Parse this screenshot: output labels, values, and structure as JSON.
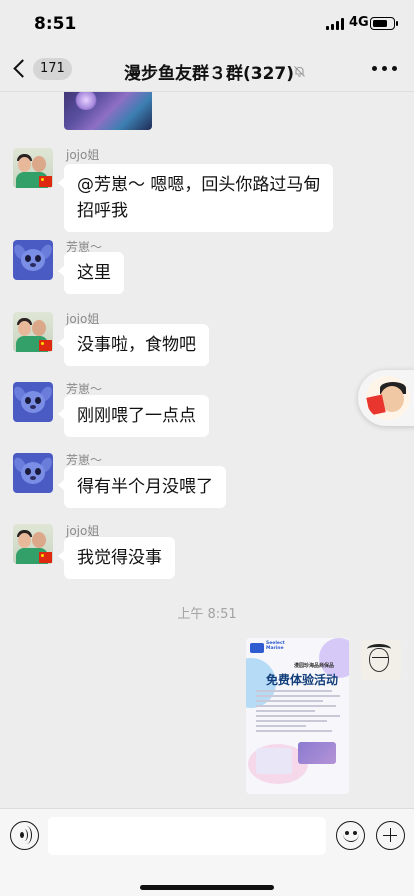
{
  "status_bar": {
    "time": "8:51",
    "network": "4G",
    "battery_level": 0.75
  },
  "nav": {
    "unread_count": "171",
    "title": "漫步鱼友群３群(327)",
    "icons": {
      "back": "chevron-left-icon",
      "mute": "bell-off-icon",
      "more": "more-dots-icon"
    }
  },
  "messages": [
    {
      "sender": "jojo姐",
      "text_lines": [
        "@芳崽～ 嗯嗯，回头你路过马甸",
        "招呼我"
      ]
    },
    {
      "sender": "芳崽～",
      "text": "这里"
    },
    {
      "sender": "jojo姐",
      "text": "没事啦，食物吧"
    },
    {
      "sender": "芳崽～",
      "text": "刚刚喂了一点点"
    },
    {
      "sender": "芳崽～",
      "text": "得有半个月没喂了"
    },
    {
      "sender": "jojo姐",
      "text": "我觉得没事"
    }
  ],
  "time_divider": "上午 8:51",
  "poster": {
    "brand": "Seelect\nMarine",
    "subtitle": "漫园珍海品商保品",
    "title": "免费体验活动"
  },
  "input": {
    "placeholder": "",
    "icons": {
      "voice": "voice-icon",
      "emoji": "emoji-icon",
      "plus": "plus-icon"
    }
  },
  "colors": {
    "background": "#ededed",
    "bubble": "#ffffff",
    "text": "#111111",
    "secondary_text": "#8a8a8a"
  }
}
